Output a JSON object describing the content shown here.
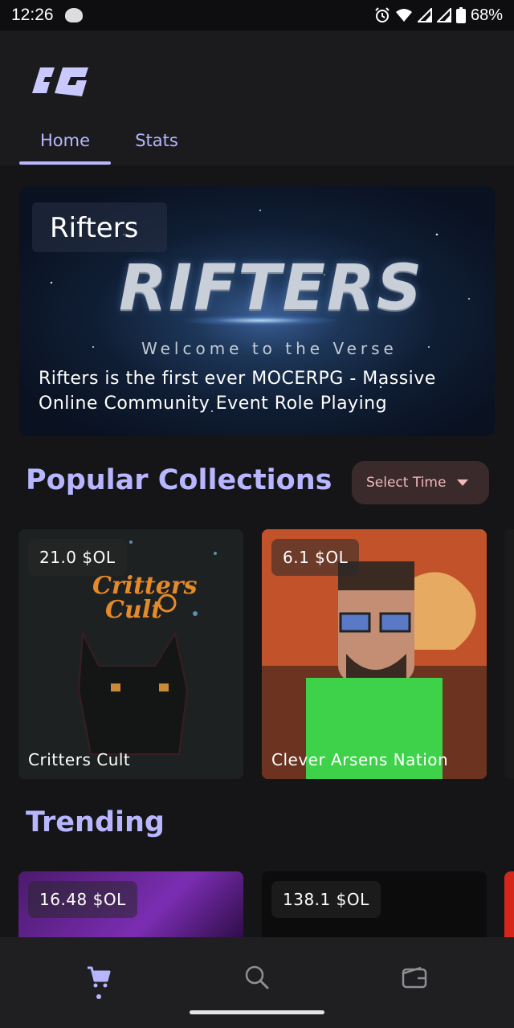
{
  "status": {
    "time": "12:26",
    "battery": "68%"
  },
  "header": {
    "logo_text": "aG",
    "tabs": [
      {
        "label": "Home",
        "active": true
      },
      {
        "label": "Stats",
        "active": false
      }
    ]
  },
  "hero": {
    "title": "Rifters",
    "logo_text": "RIFTERS",
    "tagline": "Welcome to the Verse",
    "description": "Rifters is the first ever MOCERPG - Massive Online Community Event Role Playing"
  },
  "popular": {
    "title": "Popular Collections",
    "select_label": "Select Time",
    "cards": [
      {
        "price": "21.0 $OL",
        "name": "Critters Cult",
        "art_text": "Critters Cult"
      },
      {
        "price": "6.1 $OL",
        "name": "Clever Arsens Nation"
      }
    ]
  },
  "trending": {
    "title": "Trending",
    "cards": [
      {
        "price": "16.48 $OL"
      },
      {
        "price": "138.1 $OL"
      }
    ]
  },
  "colors": {
    "accent": "#b7b6ff",
    "background": "#151517",
    "select_bg": "#3a2a2c",
    "select_text": "#f3b8b8"
  },
  "icons": [
    "cart-icon",
    "search-icon",
    "wallet-icon",
    "alarm-icon",
    "wifi-icon",
    "signal-icon",
    "battery-icon"
  ]
}
